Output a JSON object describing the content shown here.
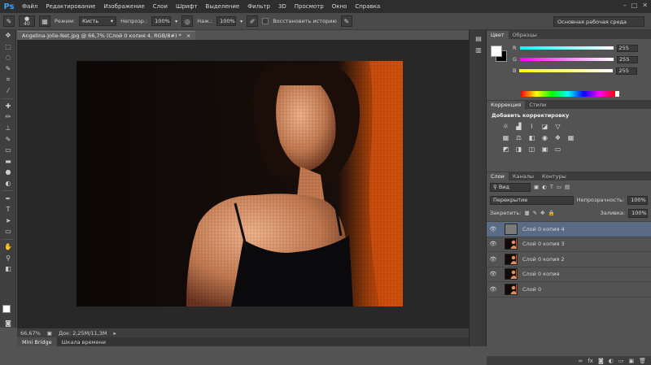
{
  "app": {
    "logo": "Ps"
  },
  "menu": [
    "Файл",
    "Редактирование",
    "Изображение",
    "Слои",
    "Шрифт",
    "Выделение",
    "Фильтр",
    "3D",
    "Просмотр",
    "Окно",
    "Справка"
  ],
  "options": {
    "brush_size": "40",
    "mode_label": "Режим:",
    "mode_value": "Кисть",
    "opacity_label": "Непрозр.:",
    "opacity_value": "100%",
    "flow_label": "Наж.:",
    "flow_value": "100%",
    "restore_history": "Восстановить историю",
    "workspace": "Основная рабочая среда"
  },
  "document": {
    "tab_title": "Angelina-Jolie-Net.jpg @ 66,7% (Слой 0 копия 4, RGB/8#) *",
    "close": "×",
    "zoom": "66,67%",
    "doc_info": "Док: 2,25M/11,3M"
  },
  "bottom_tabs": [
    "Mini Bridge",
    "Шкала времени"
  ],
  "color_panel": {
    "tabs": [
      "Цвет",
      "Образцы"
    ],
    "channels": [
      {
        "label": "R",
        "value": "255",
        "gradient": "linear-gradient(to right,#00ffff,#ffffff)"
      },
      {
        "label": "G",
        "value": "255",
        "gradient": "linear-gradient(to right,#ff00ff,#ffffff)"
      },
      {
        "label": "B",
        "value": "255",
        "gradient": "linear-gradient(to right,#ffff00,#ffffff)"
      }
    ]
  },
  "adjustments": {
    "tabs": [
      "Коррекция",
      "Стили"
    ],
    "title": "Добавить корректировку"
  },
  "layers": {
    "tabs": [
      "Слои",
      "Каналы",
      "Контуры"
    ],
    "filter_label": "Вид",
    "blend_mode": "Перекрытие",
    "opacity_label": "Непрозрачность:",
    "opacity_value": "100%",
    "lock_label": "Закрепить:",
    "fill_label": "Заливка:",
    "fill_value": "100%",
    "items": [
      {
        "name": "Слой 0 копия 4",
        "selected": true,
        "thumb": "gray"
      },
      {
        "name": "Слой 0 копия 3",
        "selected": false,
        "thumb": "photo"
      },
      {
        "name": "Слой 0 копия 2",
        "selected": false,
        "thumb": "photo"
      },
      {
        "name": "Слой 0 копия",
        "selected": false,
        "thumb": "photo"
      },
      {
        "name": "Слой 0",
        "selected": false,
        "thumb": "photo"
      }
    ]
  },
  "colors": {
    "accent": "#2fa3ff",
    "selected_layer": "#5a6b86"
  }
}
